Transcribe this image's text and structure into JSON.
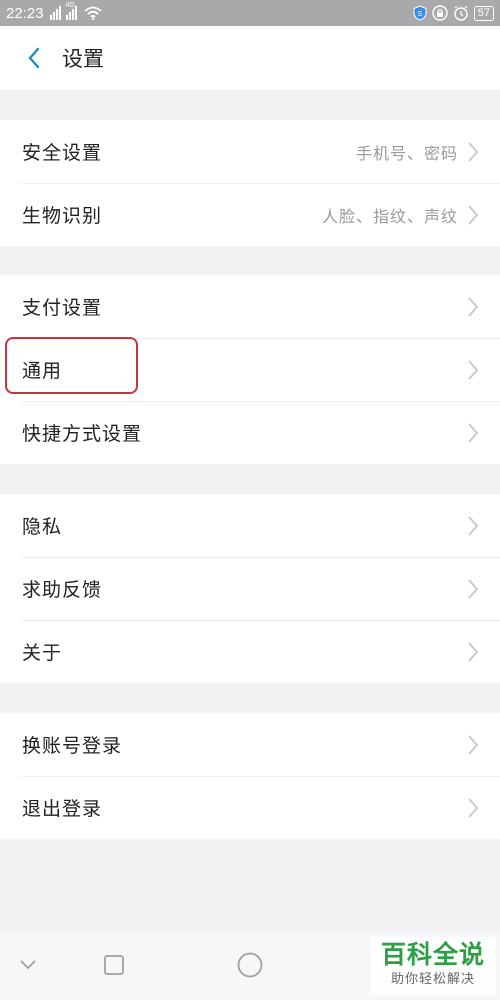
{
  "status_bar": {
    "time": "22:23",
    "network_label": "4G",
    "battery": "57"
  },
  "header": {
    "title": "设置"
  },
  "groups": [
    {
      "items": [
        {
          "label": "安全设置",
          "hint": "手机号、密码"
        },
        {
          "label": "生物识别",
          "hint": "人脸、指纹、声纹"
        }
      ]
    },
    {
      "items": [
        {
          "label": "支付设置"
        },
        {
          "label": "通用"
        },
        {
          "label": "快捷方式设置"
        }
      ]
    },
    {
      "items": [
        {
          "label": "隐私"
        },
        {
          "label": "求助反馈"
        },
        {
          "label": "关于"
        }
      ]
    },
    {
      "items": [
        {
          "label": "换账号登录"
        },
        {
          "label": "退出登录"
        }
      ]
    }
  ],
  "watermark": {
    "main": "百科全说",
    "sub": "助你轻松解决"
  },
  "colors": {
    "accent": "#1a8fbf",
    "highlight": "#c0383e",
    "watermark": "#2c9f45"
  }
}
